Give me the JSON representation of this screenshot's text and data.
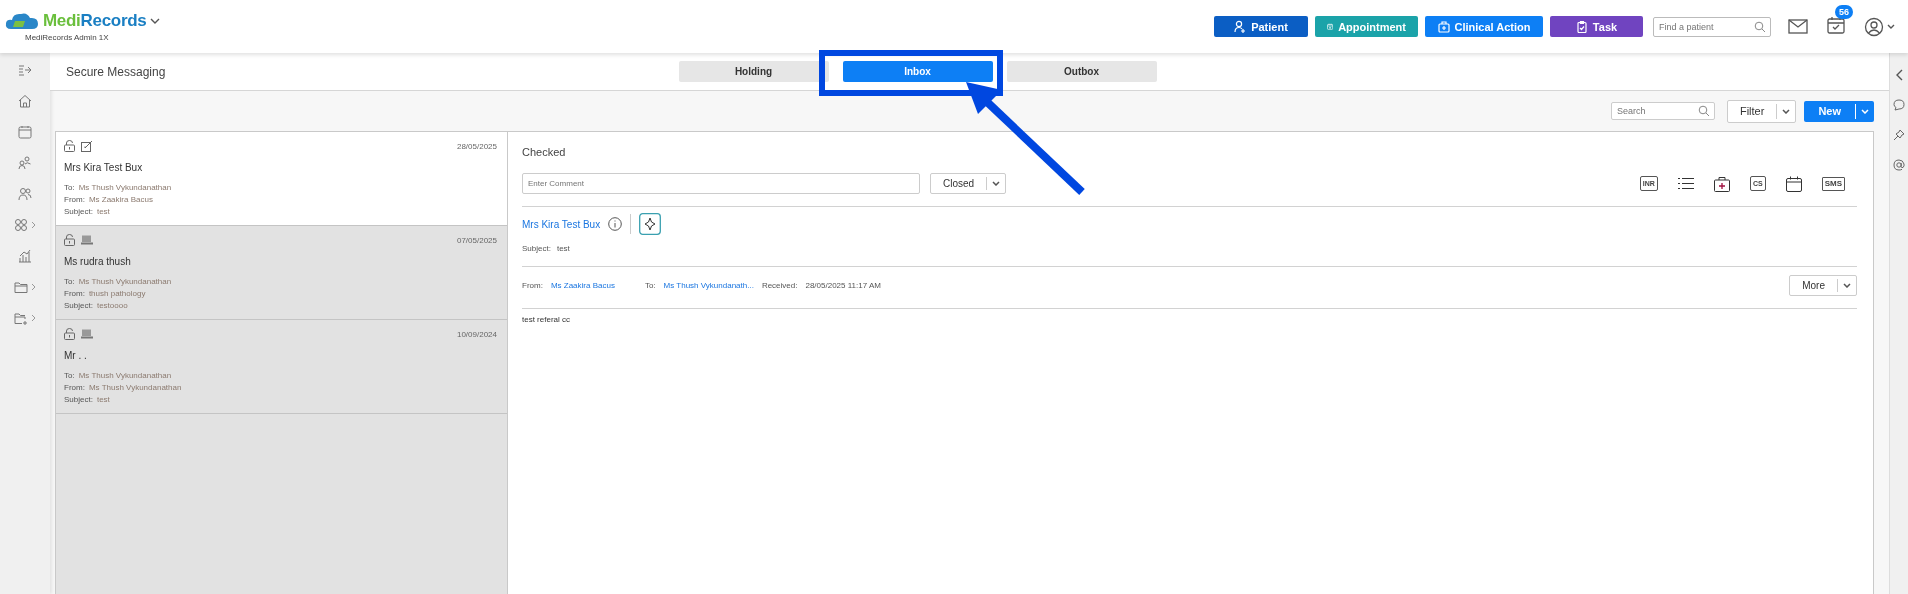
{
  "header": {
    "logo_text": [
      "Medi",
      "Records"
    ],
    "account": "MediRecords Admin 1X",
    "actions": [
      {
        "label": "Patient",
        "kind": "person",
        "color": "#0b5ec4"
      },
      {
        "label": "Appointment",
        "kind": "calendar",
        "color": "#1ba3a9"
      },
      {
        "label": "Clinical Action",
        "kind": "medkit",
        "color": "#0d7ff5"
      },
      {
        "label": "Task",
        "kind": "clipboard",
        "color": "#7044c0"
      }
    ],
    "search": {
      "placeholder": "Find a patient"
    },
    "tasks_badge": "56"
  },
  "nav": [
    {
      "kind": "collapse",
      "expandable": false
    },
    {
      "kind": "home",
      "expandable": false
    },
    {
      "kind": "calendar",
      "expandable": false
    },
    {
      "kind": "group",
      "expandable": false
    },
    {
      "kind": "people",
      "expandable": false
    },
    {
      "kind": "apps",
      "expandable": true
    },
    {
      "kind": "chart",
      "expandable": false
    },
    {
      "kind": "folder",
      "expandable": true
    },
    {
      "kind": "folder-plus",
      "expandable": true
    }
  ],
  "page_title": "Secure Messaging",
  "tabs": [
    {
      "label": "Holding",
      "selected": false
    },
    {
      "label": "Inbox",
      "selected": true
    },
    {
      "label": "Outbox",
      "selected": false
    }
  ],
  "toolbar": {
    "search": {
      "placeholder": "Search"
    },
    "filter": "Filter",
    "new": "New"
  },
  "messages": [
    {
      "selected": true,
      "kind": "pencil",
      "date": "28/05/2025",
      "name": "Mrs Kira Test Bux",
      "to_label": "To:",
      "to": "Ms Thush Vykundanathan",
      "from_label": "From:",
      "from": "Ms Zaakira Bacus",
      "subject_label": "Subject:",
      "subject": "test"
    },
    {
      "selected": false,
      "kind": "monitor",
      "date": "07/05/2025",
      "name": "Ms rudra thush",
      "to_label": "To:",
      "to": "Ms Thush Vykundanathan",
      "from_label": "From:",
      "from": "thush pathology",
      "subject_label": "Subject:",
      "subject": "testoooo"
    },
    {
      "selected": false,
      "kind": "monitor",
      "date": "10/09/2024",
      "name": "Mr . .",
      "to_label": "To:",
      "to": "Ms Thush Vykundanathan",
      "from_label": "From:",
      "from": "Ms Thush Vykundanathan",
      "subject_label": "Subject:",
      "subject": "test"
    }
  ],
  "detail": {
    "status": "Checked",
    "comment": {
      "placeholder": "Enter Comment"
    },
    "state": "Closed",
    "action_icons": [
      {
        "kind": "text",
        "label": "INR"
      },
      {
        "kind": "list"
      },
      {
        "kind": "medkit"
      },
      {
        "kind": "text",
        "label": "CS"
      },
      {
        "kind": "calendar"
      },
      {
        "kind": "bubble",
        "label": "SMS"
      }
    ],
    "patient": "Mrs Kira Test Bux",
    "subject_label": "Subject:",
    "subject": "test",
    "from_label": "From:",
    "from": "Ms Zaakira Bacus",
    "to_label": "To:",
    "to": "Ms Thush Vykundanath...",
    "received_label": "Received:",
    "received": "28/05/2025 11:17 AM",
    "more": "More",
    "body": "test referal cc"
  },
  "right_rail": [
    {
      "kind": "chevron"
    },
    {
      "kind": "chat"
    },
    {
      "kind": "pin"
    },
    {
      "kind": "at"
    }
  ]
}
